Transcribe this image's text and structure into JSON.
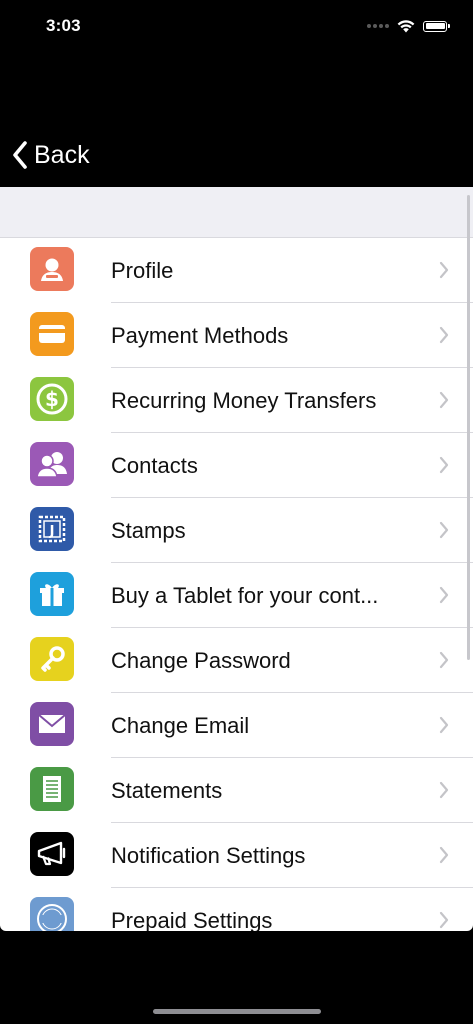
{
  "status_bar": {
    "time": "3:03"
  },
  "nav": {
    "back_label": "Back"
  },
  "menu": {
    "items": [
      {
        "label": "Profile",
        "icon": "profile-icon",
        "color": "#ec7a5c"
      },
      {
        "label": "Payment Methods",
        "icon": "card-icon",
        "color": "#f39a1e"
      },
      {
        "label": "Recurring Money Transfers",
        "icon": "dollar-icon",
        "color": "#8cc63f"
      },
      {
        "label": "Contacts",
        "icon": "contacts-icon",
        "color": "#9b59b6"
      },
      {
        "label": "Stamps",
        "icon": "stamp-icon",
        "color": "#2f5aa8"
      },
      {
        "label": "Buy a Tablet for your cont...",
        "icon": "gift-icon",
        "color": "#1ea0dc"
      },
      {
        "label": "Change Password",
        "icon": "key-icon",
        "color": "#e6d21e"
      },
      {
        "label": "Change Email",
        "icon": "envelope-icon",
        "color": "#7f4ea5"
      },
      {
        "label": "Statements",
        "icon": "document-icon",
        "color": "#4a9a45"
      },
      {
        "label": "Notification Settings",
        "icon": "megaphone-icon",
        "color": "#000000"
      },
      {
        "label": "Prepaid Settings",
        "icon": "paid-stamp-icon",
        "color": "#6e9bd0"
      }
    ]
  }
}
